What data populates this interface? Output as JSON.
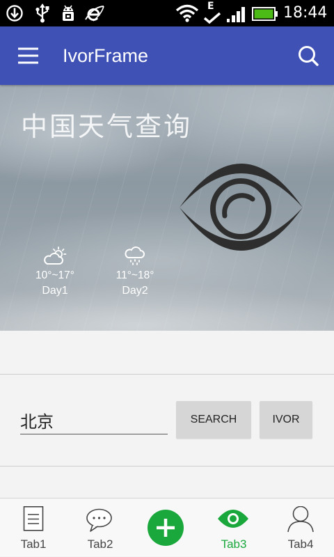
{
  "status_bar": {
    "time": "18:44",
    "network_type": "E",
    "battery_color": "#4cbb17",
    "icons": {
      "left": [
        "download-icon",
        "usb-icon",
        "usb-debugging-icon",
        "sync-icon"
      ],
      "right": [
        "wifi-icon",
        "data-activity-icon",
        "signal-icon",
        "battery-icon"
      ]
    }
  },
  "app_bar": {
    "title": "IvorFrame",
    "background": "#3f51b5",
    "menu_icon": "menu-icon",
    "search_icon": "search-icon"
  },
  "hero": {
    "title": "中国天气查询",
    "logo_icon": "eye-logo-icon",
    "forecast": [
      {
        "icon": "partly-cloudy-icon",
        "temperature": "10°~17°",
        "day": "Day1"
      },
      {
        "icon": "rain-icon",
        "temperature": "11°~18°",
        "day": "Day2"
      }
    ]
  },
  "search": {
    "city_value": "北京",
    "search_button_label": "SEARCH",
    "ivor_button_label": "IVOR"
  },
  "bottom_nav": {
    "accent_color": "#1aa83c",
    "add_button_icon": "plus-icon",
    "tabs": [
      {
        "label": "Tab1",
        "icon": "document-icon",
        "active": false
      },
      {
        "label": "Tab2",
        "icon": "chat-icon",
        "active": false
      },
      {
        "label": "Tab3",
        "icon": "eye-icon",
        "active": true
      },
      {
        "label": "Tab4",
        "icon": "person-icon",
        "active": false
      }
    ]
  }
}
